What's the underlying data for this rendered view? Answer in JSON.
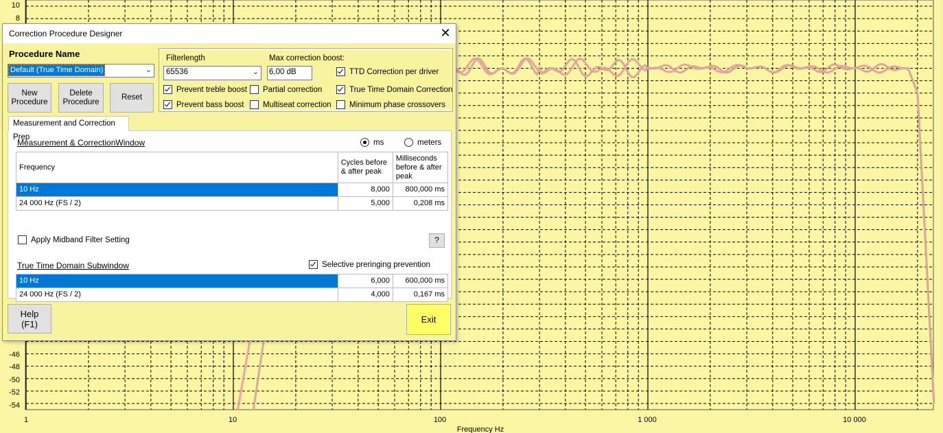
{
  "chart": {
    "y_ticks": [
      "10",
      "8",
      "-46",
      "-48",
      "-50",
      "-52",
      "-54"
    ],
    "x_ticks": [
      "1",
      "10",
      "100",
      "1 000",
      "10 000"
    ],
    "x_label": "Frequency Hz"
  },
  "chart_data": {
    "type": "line",
    "xlabel": "Frequency Hz",
    "ylabel": "",
    "xscale": "log",
    "xlim": [
      1,
      24000
    ],
    "ylim": [
      -55,
      11
    ],
    "grid": true,
    "series": [
      {
        "x": [
          10.5,
          12,
          14,
          20,
          40,
          100,
          300,
          1000,
          3000,
          10000,
          18000,
          20000,
          22000,
          24000
        ],
        "y": [
          -55,
          -44,
          -30,
          -8,
          0,
          0,
          0,
          0,
          0,
          0,
          0,
          -4,
          -30,
          -54
        ]
      },
      {
        "x": [
          12.5,
          14,
          16,
          22,
          40,
          100,
          300,
          1000,
          3000,
          10000,
          18000,
          20000,
          22000,
          24000
        ],
        "y": [
          -55,
          -44,
          -30,
          -8,
          0,
          0,
          0,
          0,
          0,
          0,
          0,
          -4,
          -30,
          -54
        ]
      }
    ],
    "colors": [
      "#f0a0a0",
      "#d6aa98"
    ]
  },
  "dialog": {
    "title": "Correction Procedure Designer",
    "procedure_name_label": "Procedure Name",
    "procedure_selected": "Default (True Time Domain)",
    "buttons": {
      "new": "New Procedure",
      "delete": "Delete Procedure",
      "reset": "Reset",
      "help": "Help (F1)",
      "exit": "Exit",
      "question": "?"
    },
    "filterlength_label": "Filterlength",
    "filterlength_value": "65536",
    "max_boost_label": "Max correction boost:",
    "max_boost_value": "6,00 dB",
    "checkboxes": {
      "ttd_per_driver": {
        "label": "TTD Correction per driver",
        "checked": true
      },
      "prevent_treble": {
        "label": "Prevent treble boost",
        "checked": true
      },
      "partial": {
        "label": "Partial correction",
        "checked": false
      },
      "ttd_correction": {
        "label": "True Time Domain Correction",
        "checked": true
      },
      "prevent_bass": {
        "label": "Prevent bass boost",
        "checked": true
      },
      "multiseat": {
        "label": "Multiseat correction",
        "checked": false
      },
      "min_phase": {
        "label": "Minimum phase crossovers",
        "checked": false
      },
      "midband": {
        "label": "Apply Midband Filter Setting",
        "checked": false
      },
      "preringing": {
        "label": "Selective preringing prevention",
        "checked": true
      }
    },
    "tab_label": "Measurement and Correction Prep",
    "measurement_section": "Measurement & CorrectionWindow",
    "radio_ms": "ms",
    "radio_meters": "meters",
    "table_headers": {
      "frequency": "Frequency",
      "cycles": "Cycles before & after peak",
      "ms": "Milliseconds before & after peak"
    },
    "measurement_rows": [
      {
        "freq": "10 Hz",
        "cycles": "8,000",
        "ms": "800,000 ms"
      },
      {
        "freq": "24 000 Hz (FS / 2)",
        "cycles": "5,000",
        "ms": "0,208 ms"
      }
    ],
    "ttd_section": "True Time Domain Subwindow",
    "ttd_rows": [
      {
        "freq": "10 Hz",
        "cycles": "6,000",
        "ms": "600,000 ms"
      },
      {
        "freq": "24 000 Hz (FS / 2)",
        "cycles": "4,000",
        "ms": "0,167 ms"
      }
    ]
  }
}
